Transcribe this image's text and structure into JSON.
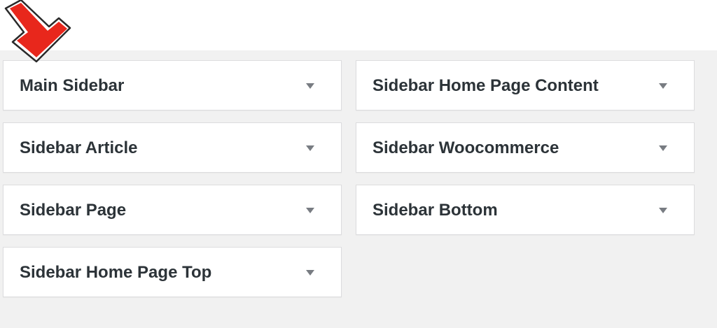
{
  "sidebars": {
    "main_sidebar": "Main Sidebar",
    "home_page_content": "Sidebar Home Page Content",
    "article": "Sidebar Article",
    "woocommerce": "Sidebar Woocommerce",
    "page": "Sidebar Page",
    "bottom": "Sidebar Bottom",
    "home_page_top": "Sidebar Home Page Top"
  },
  "icons": {
    "toggle": "chevron-down-icon",
    "annotation": "red-arrow-icon"
  },
  "colors": {
    "workspace_bg": "#f1f1f1",
    "panel_bg": "#ffffff",
    "panel_border": "#dcdcde",
    "title_text": "#2c3338",
    "toggle_icon": "#787c82",
    "arrow_fill": "#e8271c"
  }
}
